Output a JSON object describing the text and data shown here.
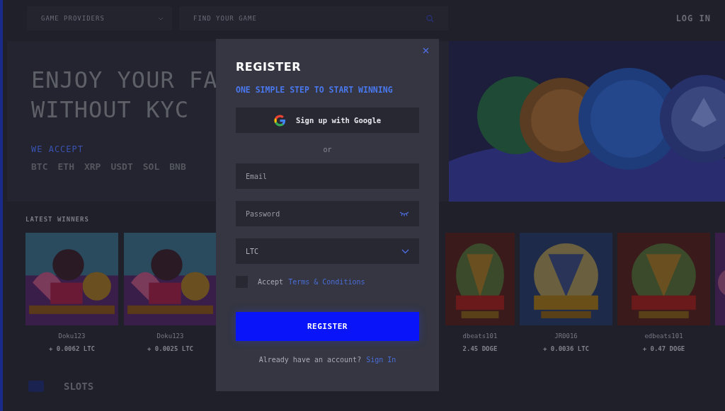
{
  "header": {
    "provider_select": {
      "placeholder": "GAME PROVIDERS"
    },
    "search": {
      "placeholder": "FIND YOUR GAME"
    },
    "login": "LOG IN"
  },
  "hero": {
    "title_lines": [
      "ENJOY YOUR FA",
      "WITHOUT KYC"
    ],
    "accept_label": "WE ACCEPT",
    "currencies": [
      "BTC",
      "ETH",
      "XRP",
      "USDT",
      "SOL",
      "BNB"
    ],
    "kind": "picture"
  },
  "latest_winners": {
    "title": "LATEST WINNERS",
    "winners": [
      {
        "name": "Doku123",
        "amount": "+ 0.0062 LTC"
      },
      {
        "name": "Doku123",
        "amount": "+ 0.0025 LTC"
      },
      {
        "name": "dbeats101",
        "amount": "2.45 DOGE"
      },
      {
        "name": "JR0016",
        "amount": "+ 0.0036 LTC"
      },
      {
        "name": "edbeats101",
        "amount": "+ 0.47 DOGE"
      }
    ]
  },
  "slots": {
    "title": "SLOTS"
  },
  "modal": {
    "title": "REGISTER",
    "subtitle": "ONE SIMPLE STEP TO START WINNING",
    "google_button": "Sign up with Google",
    "separator": "or",
    "email": {
      "placeholder": "Email"
    },
    "password": {
      "placeholder": "Password"
    },
    "currency": {
      "value": "LTC"
    },
    "terms": {
      "checked": false,
      "prefix": "Accept",
      "link": "Terms & Conditions"
    },
    "submit": "REGISTER",
    "footer": {
      "text": "Already have an account?",
      "link": "Sign In"
    }
  }
}
